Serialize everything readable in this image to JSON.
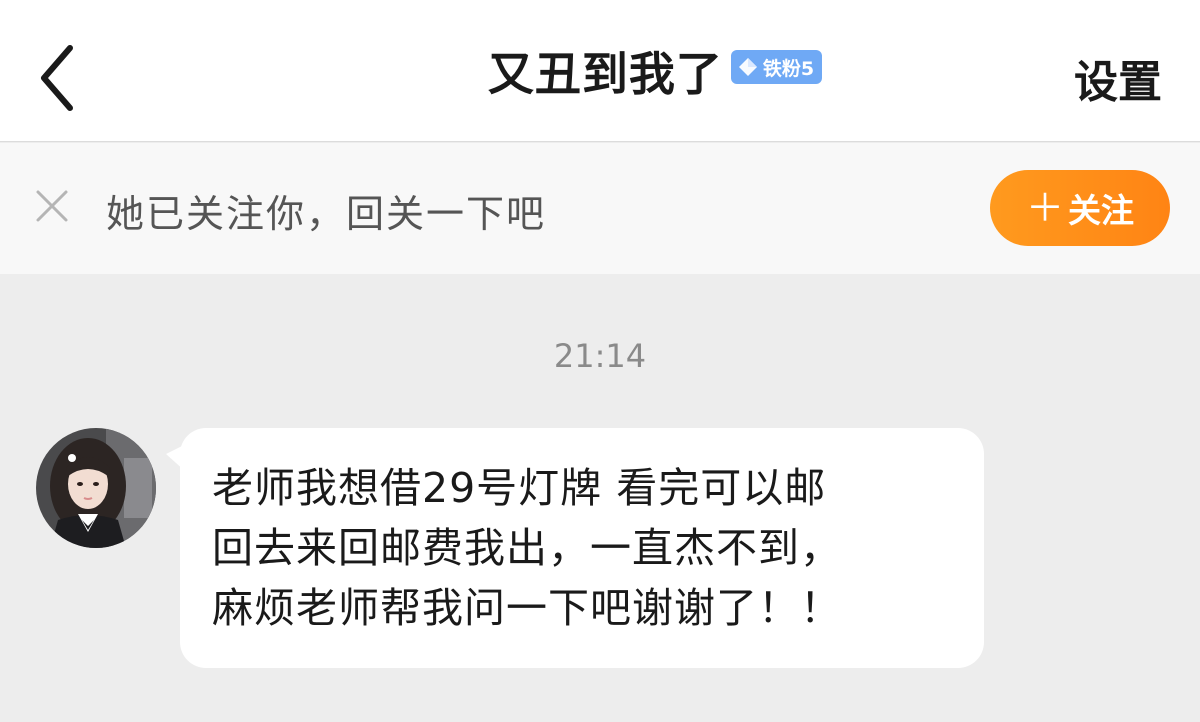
{
  "header": {
    "title": "又丑到我了",
    "badge": {
      "label": "铁粉5",
      "icon": "diamond-icon"
    },
    "settings_label": "设置",
    "back_icon": "chevron-left-icon"
  },
  "follow_prompt": {
    "text": "她已关注你，回关一下吧",
    "button_label": "关注",
    "button_icon": "plus-icon",
    "close_icon": "close-icon"
  },
  "chat": {
    "timestamp": "21:14",
    "messages": [
      {
        "lines": [
          "老师我想借29号灯牌 看完可以邮",
          "回去来回邮费我出，一直杰不到，",
          "麻烦老师帮我问一下吧谢谢了！！"
        ]
      }
    ]
  },
  "colors": {
    "accent": "#ff8c19",
    "badge": "#6fa9f5",
    "background": "#ededed"
  }
}
